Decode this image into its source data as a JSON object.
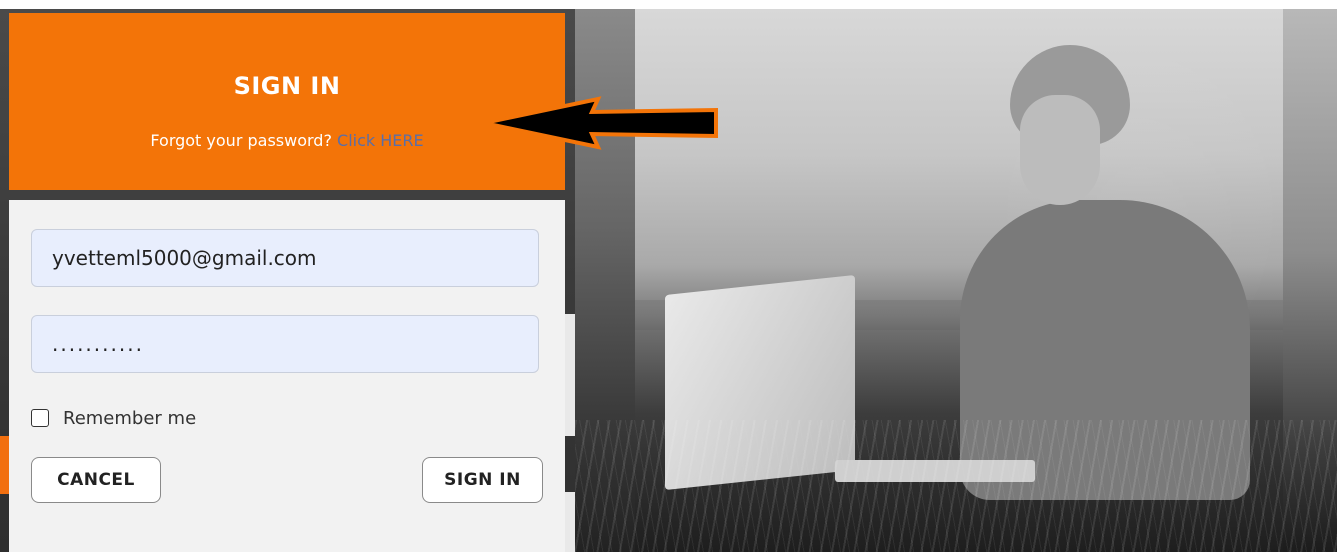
{
  "header": {
    "title": "SIGN IN",
    "forgot_prefix": "Forgot your password?",
    "forgot_link": "Click HERE"
  },
  "form": {
    "email_value": "yvetteml5000@gmail.com",
    "password_value": "...........",
    "remember_label": "Remember me",
    "remember_checked": false,
    "cancel_label": "CANCEL",
    "signin_label": "SIGN IN"
  },
  "colors": {
    "header_orange": "#f37408",
    "link_blue": "#5a6ea8",
    "input_bg": "#e8eefd"
  }
}
